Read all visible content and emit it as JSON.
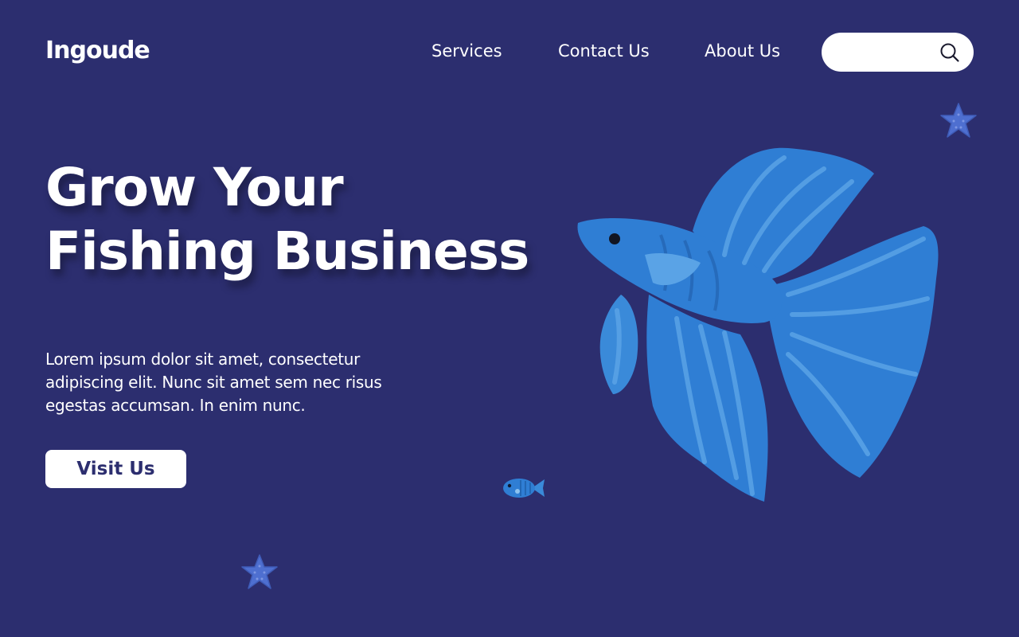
{
  "brand": {
    "name": "Ingoude"
  },
  "nav": {
    "items": [
      {
        "label": "Services"
      },
      {
        "label": "Contact Us"
      },
      {
        "label": "About Us"
      }
    ]
  },
  "search": {
    "placeholder": "",
    "value": "",
    "icon": "search-icon"
  },
  "hero": {
    "title_line1": "Grow Your",
    "title_line2": "Fishing Business",
    "description": "Lorem ipsum dolor sit amet, consectetur adipiscing elit. Nunc sit amet sem nec risus egestas accumsan. In enim nunc.",
    "cta_label": "Visit Us"
  },
  "illustrations": [
    "betta-fish-illustration",
    "small-fish-illustration",
    "starfish-icon",
    "starfish-icon"
  ],
  "colors": {
    "background": "#2c2e6f",
    "text": "#ffffff",
    "button_text": "#2c2e6f",
    "fish_body": "#2f7ed4",
    "fish_fin_light": "#4a96e0",
    "starfish": "#4e6fd0"
  }
}
